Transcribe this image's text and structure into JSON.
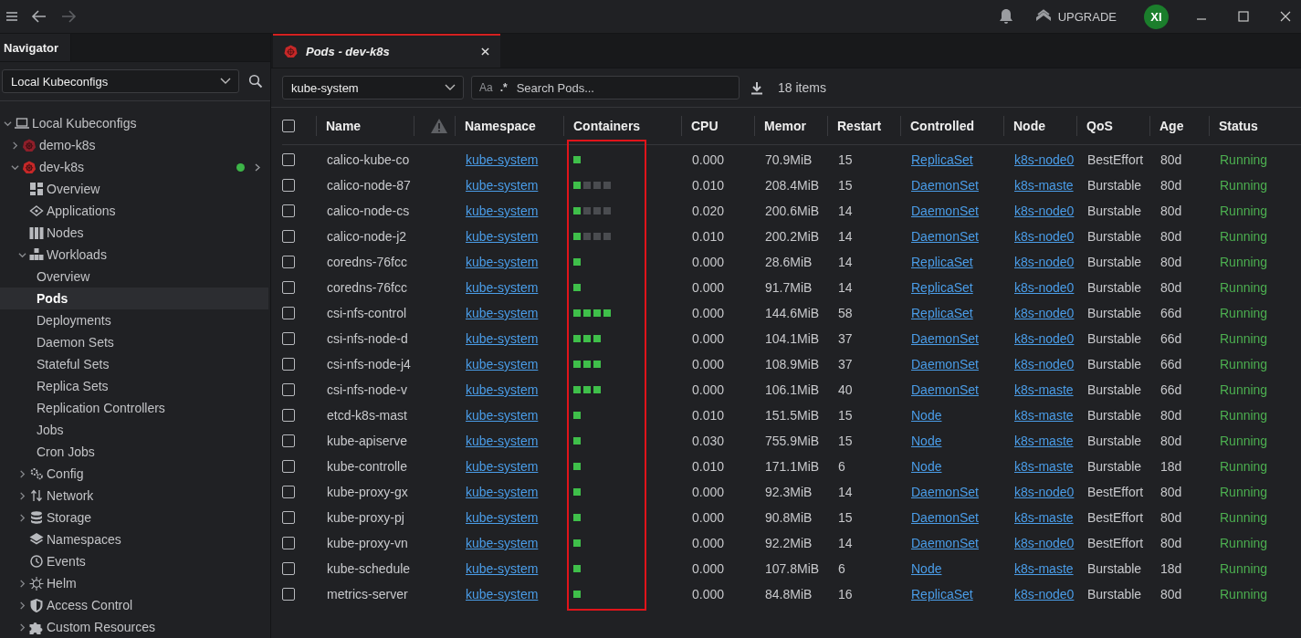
{
  "topbar": {
    "back_disabled": false,
    "forward_disabled": true,
    "upgrade": "UPGRADE",
    "avatar": "XI"
  },
  "navigator": {
    "tab": "Navigator",
    "source": "Local Kubeconfigs",
    "tree": [
      {
        "label": "Local Kubeconfigs",
        "kind": "laptop",
        "expanded": true,
        "children": [
          {
            "label": "demo-k8s",
            "kind": "cluster",
            "expanded": false,
            "connected": false
          },
          {
            "label": "dev-k8s",
            "kind": "cluster",
            "expanded": true,
            "connected": true,
            "children": [
              {
                "label": "Overview",
                "kind": "dashboard",
                "selected": false
              },
              {
                "label": "Applications",
                "kind": "apps",
                "selected": false
              },
              {
                "label": "Nodes",
                "kind": "nodes",
                "selected": false
              },
              {
                "label": "Workloads",
                "kind": "workloads",
                "expanded": true,
                "children": [
                  {
                    "label": "Overview",
                    "selected": false
                  },
                  {
                    "label": "Pods",
                    "selected": true
                  },
                  {
                    "label": "Deployments",
                    "selected": false
                  },
                  {
                    "label": "Daemon Sets",
                    "selected": false
                  },
                  {
                    "label": "Stateful Sets",
                    "selected": false
                  },
                  {
                    "label": "Replica Sets",
                    "selected": false
                  },
                  {
                    "label": "Replication Controllers",
                    "selected": false
                  },
                  {
                    "label": "Jobs",
                    "selected": false
                  },
                  {
                    "label": "Cron Jobs",
                    "selected": false
                  }
                ]
              },
              {
                "label": "Config",
                "kind": "config",
                "expanded": false
              },
              {
                "label": "Network",
                "kind": "network",
                "expanded": false
              },
              {
                "label": "Storage",
                "kind": "storage",
                "expanded": false
              },
              {
                "label": "Namespaces",
                "kind": "layers",
                "selected": false
              },
              {
                "label": "Events",
                "kind": "clock",
                "selected": false
              },
              {
                "label": "Helm",
                "kind": "helm",
                "expanded": false
              },
              {
                "label": "Access Control",
                "kind": "shield",
                "expanded": false
              },
              {
                "label": "Custom Resources",
                "kind": "puzzle",
                "expanded": false
              }
            ]
          }
        ]
      }
    ]
  },
  "tabs": [
    {
      "label": "Pods - dev-k8s",
      "selected": true
    }
  ],
  "toolbar": {
    "namespace": "kube-system",
    "search_placeholder": "Search Pods...",
    "case_toggle": "Aa",
    "regex_toggle": ".*",
    "item_count": "18 items"
  },
  "table": {
    "columns": [
      "Name",
      "Namespace",
      "Containers",
      "CPU",
      "Memor",
      "Restart",
      "Controlled",
      "Node",
      "QoS",
      "Age",
      "Status"
    ],
    "containers_highlighted": true,
    "select_all_checked": false,
    "rows": [
      {
        "checked": false,
        "name": "calico-kube-co",
        "namespace": "kube-system",
        "containers": [
          {
            "ready": true
          }
        ],
        "cpu": "0.000",
        "memory": "70.9MiB",
        "restarts": "15",
        "controlled_by": "ReplicaSet",
        "node": "k8s-node0",
        "qos": "BestEffort",
        "age": "80d",
        "status": "Running"
      },
      {
        "checked": false,
        "name": "calico-node-87",
        "namespace": "kube-system",
        "containers": [
          {
            "ready": true
          },
          {
            "ready": false
          },
          {
            "ready": false
          },
          {
            "ready": false
          }
        ],
        "cpu": "0.010",
        "memory": "208.4MiB",
        "restarts": "15",
        "controlled_by": "DaemonSet",
        "node": "k8s-maste",
        "qos": "Burstable",
        "age": "80d",
        "status": "Running"
      },
      {
        "checked": false,
        "name": "calico-node-cs",
        "namespace": "kube-system",
        "containers": [
          {
            "ready": true
          },
          {
            "ready": false
          },
          {
            "ready": false
          },
          {
            "ready": false
          }
        ],
        "cpu": "0.020",
        "memory": "200.6MiB",
        "restarts": "14",
        "controlled_by": "DaemonSet",
        "node": "k8s-node0",
        "qos": "Burstable",
        "age": "80d",
        "status": "Running"
      },
      {
        "checked": false,
        "name": "calico-node-j2",
        "namespace": "kube-system",
        "containers": [
          {
            "ready": true
          },
          {
            "ready": false
          },
          {
            "ready": false
          },
          {
            "ready": false
          }
        ],
        "cpu": "0.010",
        "memory": "200.2MiB",
        "restarts": "14",
        "controlled_by": "DaemonSet",
        "node": "k8s-node0",
        "qos": "Burstable",
        "age": "80d",
        "status": "Running"
      },
      {
        "checked": false,
        "name": "coredns-76fcc",
        "namespace": "kube-system",
        "containers": [
          {
            "ready": true
          }
        ],
        "cpu": "0.000",
        "memory": "28.6MiB",
        "restarts": "14",
        "controlled_by": "ReplicaSet",
        "node": "k8s-node0",
        "qos": "Burstable",
        "age": "80d",
        "status": "Running"
      },
      {
        "checked": false,
        "name": "coredns-76fcc",
        "namespace": "kube-system",
        "containers": [
          {
            "ready": true
          }
        ],
        "cpu": "0.000",
        "memory": "91.7MiB",
        "restarts": "14",
        "controlled_by": "ReplicaSet",
        "node": "k8s-node0",
        "qos": "Burstable",
        "age": "80d",
        "status": "Running"
      },
      {
        "checked": false,
        "name": "csi-nfs-control",
        "namespace": "kube-system",
        "containers": [
          {
            "ready": true
          },
          {
            "ready": true
          },
          {
            "ready": true
          },
          {
            "ready": true
          }
        ],
        "cpu": "0.000",
        "memory": "144.6MiB",
        "restarts": "58",
        "controlled_by": "ReplicaSet",
        "node": "k8s-node0",
        "qos": "Burstable",
        "age": "66d",
        "status": "Running"
      },
      {
        "checked": false,
        "name": "csi-nfs-node-d",
        "namespace": "kube-system",
        "containers": [
          {
            "ready": true
          },
          {
            "ready": true
          },
          {
            "ready": true
          }
        ],
        "cpu": "0.000",
        "memory": "104.1MiB",
        "restarts": "37",
        "controlled_by": "DaemonSet",
        "node": "k8s-node0",
        "qos": "Burstable",
        "age": "66d",
        "status": "Running"
      },
      {
        "checked": false,
        "name": "csi-nfs-node-j4",
        "namespace": "kube-system",
        "containers": [
          {
            "ready": true
          },
          {
            "ready": true
          },
          {
            "ready": true
          }
        ],
        "cpu": "0.000",
        "memory": "108.9MiB",
        "restarts": "37",
        "controlled_by": "DaemonSet",
        "node": "k8s-node0",
        "qos": "Burstable",
        "age": "66d",
        "status": "Running"
      },
      {
        "checked": false,
        "name": "csi-nfs-node-v",
        "namespace": "kube-system",
        "containers": [
          {
            "ready": true
          },
          {
            "ready": true
          },
          {
            "ready": true
          }
        ],
        "cpu": "0.000",
        "memory": "106.1MiB",
        "restarts": "40",
        "controlled_by": "DaemonSet",
        "node": "k8s-maste",
        "qos": "Burstable",
        "age": "66d",
        "status": "Running"
      },
      {
        "checked": false,
        "name": "etcd-k8s-mast",
        "namespace": "kube-system",
        "containers": [
          {
            "ready": true
          }
        ],
        "cpu": "0.010",
        "memory": "151.5MiB",
        "restarts": "15",
        "controlled_by": "Node",
        "node": "k8s-maste",
        "qos": "Burstable",
        "age": "80d",
        "status": "Running"
      },
      {
        "checked": false,
        "name": "kube-apiserve",
        "namespace": "kube-system",
        "containers": [
          {
            "ready": true
          }
        ],
        "cpu": "0.030",
        "memory": "755.9MiB",
        "restarts": "15",
        "controlled_by": "Node",
        "node": "k8s-maste",
        "qos": "Burstable",
        "age": "80d",
        "status": "Running"
      },
      {
        "checked": false,
        "name": "kube-controlle",
        "namespace": "kube-system",
        "containers": [
          {
            "ready": true
          }
        ],
        "cpu": "0.010",
        "memory": "171.1MiB",
        "restarts": "6",
        "controlled_by": "Node",
        "node": "k8s-maste",
        "qos": "Burstable",
        "age": "18d",
        "status": "Running"
      },
      {
        "checked": false,
        "name": "kube-proxy-gx",
        "namespace": "kube-system",
        "containers": [
          {
            "ready": true
          }
        ],
        "cpu": "0.000",
        "memory": "92.3MiB",
        "restarts": "14",
        "controlled_by": "DaemonSet",
        "node": "k8s-node0",
        "qos": "BestEffort",
        "age": "80d",
        "status": "Running"
      },
      {
        "checked": false,
        "name": "kube-proxy-pj",
        "namespace": "kube-system",
        "containers": [
          {
            "ready": true
          }
        ],
        "cpu": "0.000",
        "memory": "90.8MiB",
        "restarts": "15",
        "controlled_by": "DaemonSet",
        "node": "k8s-maste",
        "qos": "BestEffort",
        "age": "80d",
        "status": "Running"
      },
      {
        "checked": false,
        "name": "kube-proxy-vn",
        "namespace": "kube-system",
        "containers": [
          {
            "ready": true
          }
        ],
        "cpu": "0.000",
        "memory": "92.2MiB",
        "restarts": "14",
        "controlled_by": "DaemonSet",
        "node": "k8s-node0",
        "qos": "BestEffort",
        "age": "80d",
        "status": "Running"
      },
      {
        "checked": false,
        "name": "kube-schedule",
        "namespace": "kube-system",
        "containers": [
          {
            "ready": true
          }
        ],
        "cpu": "0.000",
        "memory": "107.8MiB",
        "restarts": "6",
        "controlled_by": "Node",
        "node": "k8s-maste",
        "qos": "Burstable",
        "age": "18d",
        "status": "Running"
      },
      {
        "checked": false,
        "name": "metrics-server",
        "namespace": "kube-system",
        "containers": [
          {
            "ready": true
          }
        ],
        "cpu": "0.000",
        "memory": "84.8MiB",
        "restarts": "16",
        "controlled_by": "ReplicaSet",
        "node": "k8s-node0",
        "qos": "Burstable",
        "age": "80d",
        "status": "Running"
      }
    ]
  }
}
